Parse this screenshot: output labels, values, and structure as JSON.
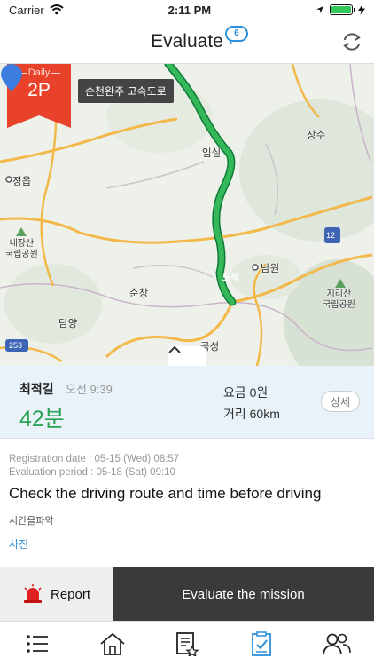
{
  "status_bar": {
    "carrier": "Carrier",
    "time": "2:11 PM",
    "battery_percent": 100
  },
  "nav": {
    "title": "Evaluate",
    "badge": "6",
    "swap_icon": "swap-arrows-icon"
  },
  "map": {
    "daily_badge": {
      "small": "Daily",
      "big": "2P"
    },
    "road_label": "순천완주 고속도로",
    "destination": "도착",
    "places": {
      "jeongeup": "정읍",
      "imsil": "임실",
      "jangsu": "장수",
      "naejangsan": "내장산",
      "naejangsan_park": "국립공원",
      "namwon": "남원",
      "sunchang": "순창",
      "damyang": "담양",
      "gokseong": "곡성",
      "jirisan": "지리산",
      "jirisan_park": "국립공원"
    },
    "shields": {
      "s253": "253",
      "s12": "12"
    }
  },
  "route": {
    "type": "최적길",
    "depart": "오전 9:39",
    "duration": "42분",
    "fee": "요금 0원",
    "distance": "거리 60km",
    "detail_label": "상세"
  },
  "mission": {
    "registration": "Registration date : 05-15 (Wed) 08:57",
    "evaluation": "Evaluation period : 05-18 (Sat) 09:10",
    "title": "Check the driving route and time before driving",
    "subtitle": "시간을파악",
    "link": "사진"
  },
  "actions": {
    "report": "Report",
    "evaluate": "Evaluate the mission"
  },
  "tabs": [
    {
      "icon": "list-icon",
      "active": false
    },
    {
      "icon": "home-icon",
      "active": false
    },
    {
      "icon": "document-star-icon",
      "active": false
    },
    {
      "icon": "checklist-icon",
      "active": true
    },
    {
      "icon": "people-icon",
      "active": false
    }
  ],
  "colors": {
    "accent": "#2b8fd9",
    "route": "#1fa149",
    "duration": "#2ba355",
    "flag": "#e8422b"
  }
}
